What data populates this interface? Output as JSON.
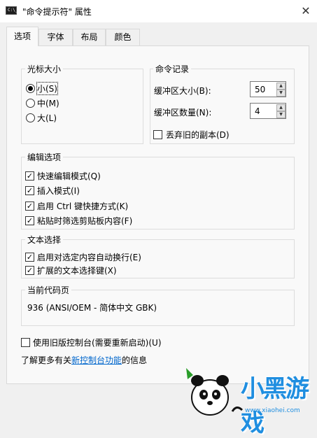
{
  "window": {
    "title": "\"命令提示符\" 属性",
    "close_glyph": "✕",
    "icon_text": "C:\\_"
  },
  "tabs": [
    "选项",
    "字体",
    "布局",
    "颜色"
  ],
  "cursor_size": {
    "legend": "光标大小",
    "options": [
      "小(S)",
      "中(M)",
      "大(L)"
    ],
    "selected_index": 0
  },
  "command_history": {
    "legend": "命令记录",
    "buffer_size_label": "缓冲区大小(B):",
    "buffer_size_value": "50",
    "buffer_count_label": "缓冲区数量(N):",
    "buffer_count_value": "4",
    "discard_label": "丢弃旧的副本(D)",
    "discard_checked": false
  },
  "edit_options": {
    "legend": "编辑选项",
    "items": [
      {
        "label": "快速编辑模式(Q)",
        "checked": true
      },
      {
        "label": "插入模式(I)",
        "checked": true
      },
      {
        "label": "启用 Ctrl 键快捷方式(K)",
        "checked": true
      },
      {
        "label": "粘贴时筛选剪贴板内容(F)",
        "checked": true
      }
    ]
  },
  "text_selection": {
    "legend": "文本选择",
    "items": [
      {
        "label": "启用对选定内容自动换行(E)",
        "checked": true
      },
      {
        "label": "扩展的文本选择键(X)",
        "checked": true
      }
    ]
  },
  "code_page": {
    "legend": "当前代码页",
    "value": "936   (ANSI/OEM - 简体中文 GBK)"
  },
  "legacy_console": {
    "label": "使用旧版控制台(需要重新启动)(U)",
    "checked": false
  },
  "learn_more": {
    "prefix": "了解更多有关",
    "link": "新控制台功能",
    "suffix": "的信息"
  },
  "watermark": {
    "brand": "小黑游戏",
    "url": "www.xiaohei.com"
  }
}
